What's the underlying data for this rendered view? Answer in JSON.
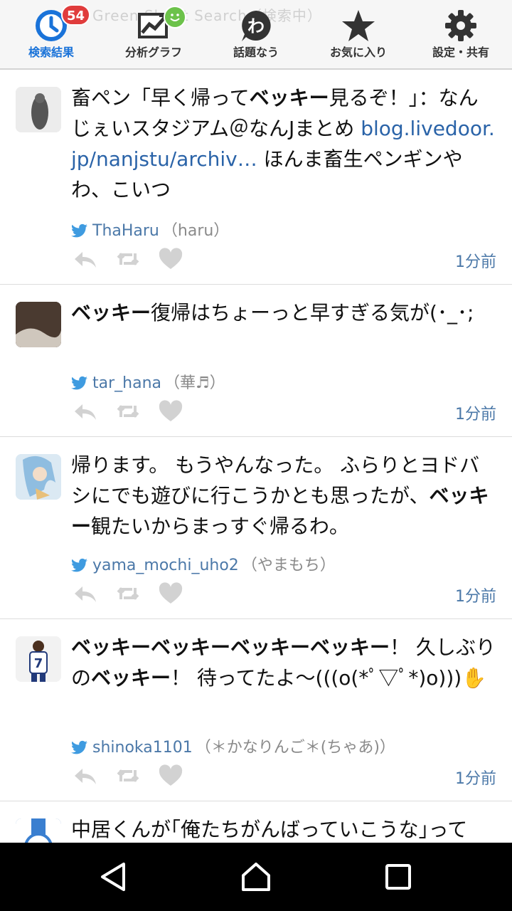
{
  "app": {
    "faint_title": "Green Sheet Search（検索中）",
    "tabs": [
      {
        "label": "検索結果",
        "icon": "clock-icon",
        "badge": "54",
        "active": true
      },
      {
        "label": "分析グラフ",
        "icon": "chart-icon",
        "badge_icon": "smile-icon"
      },
      {
        "label": "話題なう",
        "icon": "wa-icon"
      },
      {
        "label": "お気に入り",
        "icon": "star-icon"
      },
      {
        "label": "設定・共有",
        "icon": "gear-icon"
      }
    ]
  },
  "posts": [
    {
      "seg": [
        "畜ペン「早く帰って",
        "ベッキー",
        "見るぞ！」：なんじぇいスタジアム＠なんJまとめ ",
        "blog.livedoor.jp/nanjstu/archiv…",
        " ほんま畜生ペンギンやわ、こいつ"
      ],
      "user": "ThaHaru",
      "nick": "（haru）",
      "time": "1分前"
    },
    {
      "seg": [
        "",
        "ベッキー",
        "復帰はちょーっと早すぎる気が(･_･;"
      ],
      "user": "tar_hana",
      "nick": "（華♬）",
      "time": "1分前"
    },
    {
      "seg": [
        "帰ります。 もうやんなった。 ふらりとヨドバシにでも遊びに行こうかとも思ったが、",
        "ベッキー",
        "観たいからまっすぐ帰るわ。"
      ],
      "user": "yama_mochi_uho2",
      "nick": "（やまもち）",
      "time": "1分前"
    },
    {
      "seg": [
        "",
        "ベッキーベッキーベッキーベッキー",
        "！ 久しぶりの",
        "ベッキー",
        "！ 待ってたよ〜(((o(*ﾟ▽ﾟ*)o)))✋"
      ],
      "user": "shinoka1101",
      "nick": "（＊かなりんご＊(ちゃあ)）",
      "time": "1分前"
    },
    {
      "seg": [
        "中居くんが｢俺たちがんばっていこうな｣って"
      ]
    }
  ],
  "navbar": {
    "buttons": [
      "back-icon",
      "home-icon",
      "recents-icon"
    ]
  },
  "colors": {
    "accent": "#1a73d9",
    "link": "#2a63a8",
    "badge": "#e03c3c",
    "badge_green": "#6cc24a"
  }
}
